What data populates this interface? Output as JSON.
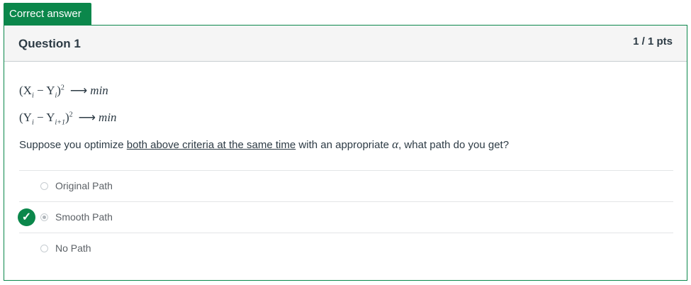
{
  "badge": {
    "label": "Correct answer"
  },
  "question": {
    "title": "Question 1",
    "points": "1 / 1 pts",
    "criteria": [
      {
        "left": "(X",
        "sub1": "i",
        "mid": " − Y",
        "sub2": "i",
        "right": ")",
        "sup": "2",
        "arrow": "⟶",
        "target": "min"
      },
      {
        "left": "(Y",
        "sub1": "i",
        "mid": " − Y",
        "sub2": "i+1",
        "right": ")",
        "sup": "2",
        "arrow": "⟶",
        "target": "min"
      }
    ],
    "prompt_before": "Suppose you optimize ",
    "prompt_underlined": "both above criteria at the same time",
    "prompt_mid": " with an appropriate ",
    "prompt_symbol": "α",
    "prompt_after": ", what path do you get?"
  },
  "answers": [
    {
      "label": "Original Path",
      "selected": false,
      "correct": false
    },
    {
      "label": "Smooth Path",
      "selected": true,
      "correct": true
    },
    {
      "label": "No Path",
      "selected": false,
      "correct": false
    }
  ],
  "icons": {
    "correct_marker": "check-icon"
  },
  "colors": {
    "success": "#0b874b",
    "text": "#2d3b45",
    "header_bg": "#f5f5f5"
  }
}
